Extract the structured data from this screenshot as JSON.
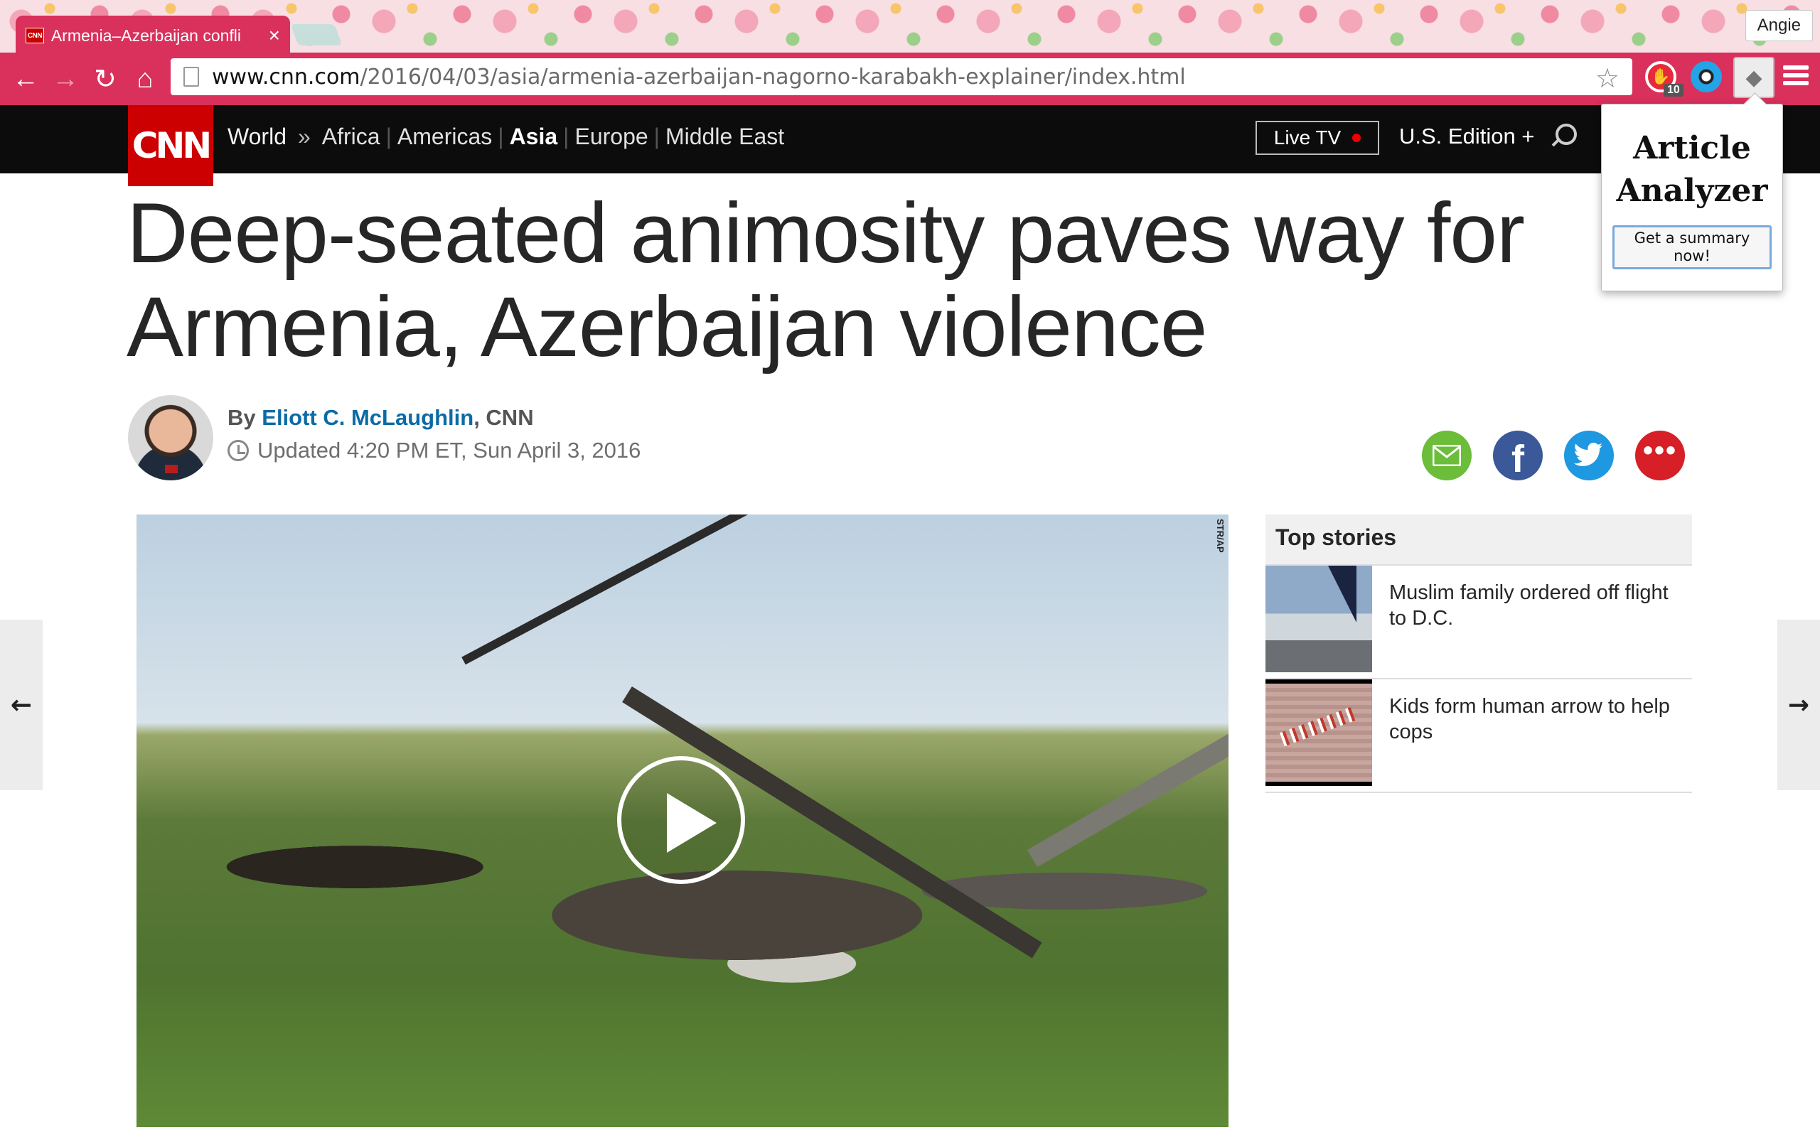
{
  "browser": {
    "tab_title": "Armenia–Azerbaijan confli",
    "tab_favicon": "CNN",
    "profile_name": "Angie",
    "url_host": "www.cnn.com",
    "url_path": "/2016/04/03/asia/armenia-azerbaijan-nagorno-karabakh-explainer/index.html",
    "extension_badge": "10",
    "icons": [
      "back-icon",
      "forward-icon",
      "reload-icon",
      "home-icon",
      "star-icon",
      "menu-icon"
    ]
  },
  "nav": {
    "logo": "CNN",
    "world": "World",
    "links": [
      "Africa",
      "Americas",
      "Asia",
      "Europe",
      "Middle East"
    ],
    "active": "Asia",
    "live_tv": "Live TV",
    "edition": "U.S. Edition +"
  },
  "popup": {
    "title_line1": "Article",
    "title_line2": "Analyzer",
    "button": "Get a summary now!"
  },
  "article": {
    "headline_line1": "Deep-seated animosity paves way for",
    "headline_line2": "Armenia, Azerbaijan violence",
    "by": "By",
    "author": "Eliott C. McLaughlin",
    "outlet": ", CNN",
    "updated": "Updated 4:20 PM ET, Sun April 3, 2016",
    "photo_credit": "STR/AP"
  },
  "top_stories": {
    "header": "Top stories",
    "items": [
      {
        "title": "Muslim family ordered off flight to D.C."
      },
      {
        "title": "Kids form human arrow to help cops"
      }
    ]
  },
  "colors": {
    "chrome": "#d9305c",
    "cnn_red": "#cc0000",
    "author_link": "#0c6ba6"
  }
}
